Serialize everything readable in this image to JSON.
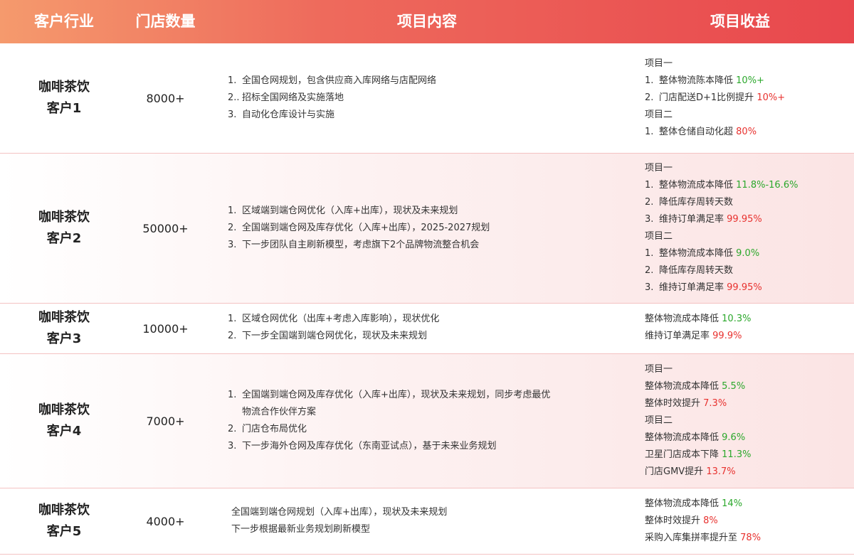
{
  "header": {
    "industry": "客户行业",
    "stores": "门店数量",
    "content": "项目内容",
    "benefit": "项目收益"
  },
  "colors": {
    "header_start": "#f59a6d",
    "header_end": "#e8474d",
    "positive": "#2ca82c",
    "negative": "#e8322f"
  },
  "rows": [
    {
      "industry": "咖啡茶饮",
      "customer": "客户1",
      "stores": "8000+",
      "content": [
        {
          "num": "1.",
          "text": "全国仓网规划，包含供应商入库网络与店配网络"
        },
        {
          "num": "2..",
          "text": "招标全国网络及实施落地"
        },
        {
          "num": "3.",
          "text": "自动化仓库设计与实施"
        }
      ],
      "benefits": [
        {
          "prefix": "",
          "text": "项目一",
          "value": ""
        },
        {
          "prefix": "1.",
          "text": "整体物流陈本降低",
          "value": "10%+"
        },
        {
          "prefix": "2.",
          "text": "门店配送D+1比例提升",
          "value": "10%+"
        },
        {
          "prefix": "",
          "text": "项目二",
          "value": ""
        },
        {
          "prefix": "1.",
          "text": "整体仓储自动化超",
          "value": "80%"
        }
      ]
    },
    {
      "industry": "咖啡茶饮",
      "customer": "客户2",
      "stores": "50000+",
      "content": [
        {
          "num": "1.",
          "text": "区域端到端仓网优化（入库+出库），现状及未来规划"
        },
        {
          "num": "2.",
          "text": "全国端到端仓网及库存优化（入库+出库），2025-2027规划"
        },
        {
          "num": "3.",
          "text": "下一步团队自主刷新模型，考虑旗下2个品牌物流整合机会"
        }
      ],
      "benefits": [
        {
          "prefix": "",
          "text": "项目一",
          "value": ""
        },
        {
          "prefix": "1.",
          "text": "整体物流成本降低",
          "value": "11.8%-16.6%"
        },
        {
          "prefix": "2.",
          "text": "降低库存周转天数",
          "value": ""
        },
        {
          "prefix": "3.",
          "text": "维持订单满足率",
          "value": "99.95%"
        },
        {
          "prefix": "",
          "text": "项目二",
          "value": ""
        },
        {
          "prefix": "1.",
          "text": "整体物流成本降低",
          "value": "9.0%"
        },
        {
          "prefix": "2.",
          "text": "降低库存周转天数",
          "value": ""
        },
        {
          "prefix": "3.",
          "text": "维持订单满足率",
          "value": "99.95%"
        }
      ]
    },
    {
      "industry": "咖啡茶饮",
      "customer": "客户3",
      "stores": "10000+",
      "content": [
        {
          "num": "1.",
          "text": "区域仓网优化（出库+考虑入库影响），现状优化"
        },
        {
          "num": "2.",
          "text": "下一步全国端到端仓网优化，现状及未来规划"
        }
      ],
      "benefits": [
        {
          "prefix": "",
          "text": "整体物流成本降低",
          "value": "10.3%"
        },
        {
          "prefix": "",
          "text": "维持订单满足率",
          "value": "99.9%"
        }
      ]
    },
    {
      "industry": "咖啡茶饮",
      "customer": "客户4",
      "stores": "7000+",
      "content": [
        {
          "num": "1.",
          "text": "全国端到端仓网及库存优化（入库+出库），现状及未来规划，同步考虑最优"
        },
        {
          "num": "",
          "text": "物流合作伙伴方案"
        },
        {
          "num": "2.",
          "text": "门店仓布局优化"
        },
        {
          "num": "3.",
          "text": "下一步海外仓网及库存优化（东南亚试点），基于未来业务规划"
        }
      ],
      "benefits": [
        {
          "prefix": "",
          "text": "项目一",
          "value": ""
        },
        {
          "prefix": "",
          "text": "整体物流成本降低",
          "value": "5.5%"
        },
        {
          "prefix": "",
          "text": "整体时效提升",
          "value": "7.3%"
        },
        {
          "prefix": "",
          "text": "项目二",
          "value": ""
        },
        {
          "prefix": "",
          "text": "整体物流成本降低",
          "value": "9.6%"
        },
        {
          "prefix": "",
          "text": "卫星门店成本下降",
          "value": "11.3%"
        },
        {
          "prefix": "",
          "text": "门店GMV提升",
          "value": "13.7%"
        }
      ]
    },
    {
      "industry": "咖啡茶饮",
      "customer": "客户5",
      "stores": "4000+",
      "content": [
        {
          "num": "",
          "text": "全国端到端仓网规划（入库+出库），现状及未来规划"
        },
        {
          "num": "",
          "text": "下一步根据最新业务规划刷新模型"
        }
      ],
      "benefits": [
        {
          "prefix": "",
          "text": "整体物流成本降低",
          "value": "14%"
        },
        {
          "prefix": "",
          "text": "整体时效提升",
          "value": "8%"
        },
        {
          "prefix": "",
          "text": "采购入库集拼率提升至",
          "value": "78%"
        }
      ]
    }
  ]
}
